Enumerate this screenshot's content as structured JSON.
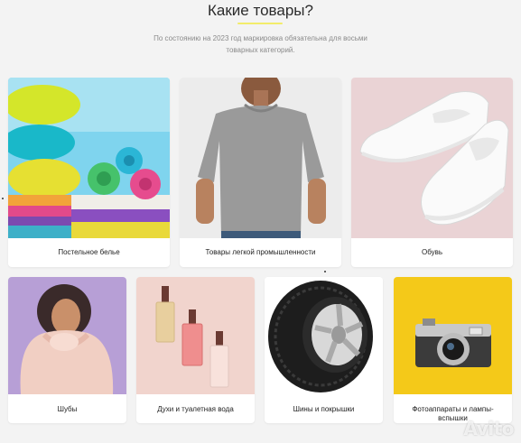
{
  "header": {
    "title": "Какие товары?",
    "subtitle_line1": "По состоянию на 2023 год маркировка обязательна для восьми",
    "subtitle_line2": "товарных категорий."
  },
  "categories": [
    {
      "label": "Постельное белье",
      "icon": "bedding-photo"
    },
    {
      "label": "Товары легкой промышленности",
      "icon": "tshirt-photo"
    },
    {
      "label": "Обувь",
      "icon": "sneakers-photo"
    },
    {
      "label": "Шубы",
      "icon": "fur-coat-photo"
    },
    {
      "label": "Духи и туалетная вода",
      "icon": "perfume-photo"
    },
    {
      "label": "Шины и покрышки",
      "icon": "tire-photo"
    },
    {
      "label": "Фотоаппараты и лампы-вспышки",
      "icon": "camera-photo"
    }
  ],
  "watermark": "Avito",
  "colors": {
    "background": "#f3f3f3",
    "accent_underline": "#f2ec6a",
    "card": "#ffffff"
  }
}
